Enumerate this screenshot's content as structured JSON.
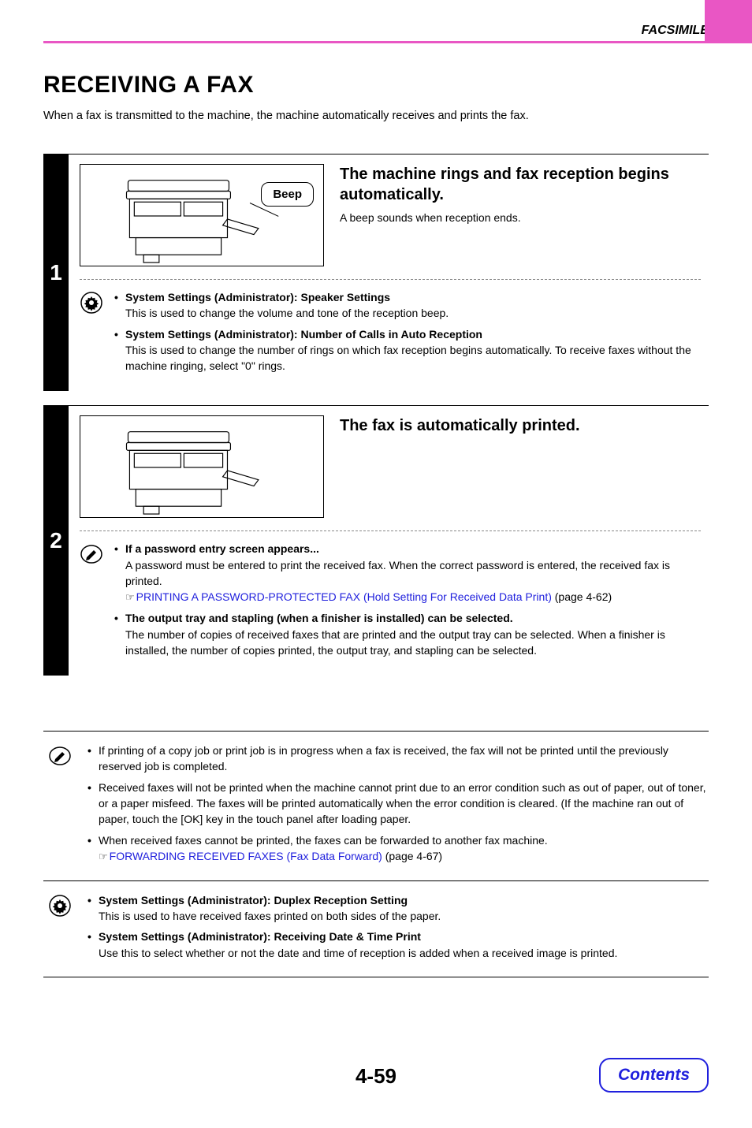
{
  "header": {
    "section": "FACSIMILE"
  },
  "title": "RECEIVING A FAX",
  "intro": "When a fax is transmitted to the machine, the machine automatically receives and prints the fax.",
  "step1": {
    "num": "1",
    "callout": "Beep",
    "heading": "The machine rings and fax reception begins automatically.",
    "desc": "A beep sounds when reception ends.",
    "notes": [
      {
        "bold": "System Settings (Administrator): Speaker Settings",
        "desc": "This is used to change the volume and tone of the reception beep."
      },
      {
        "bold": "System Settings (Administrator): Number of Calls in Auto Reception",
        "desc": "This is used to change the number of rings on which fax reception begins automatically. To receive faxes without the machine ringing, select \"0\" rings."
      }
    ]
  },
  "step2": {
    "num": "2",
    "heading": "The fax is automatically printed.",
    "notes": [
      {
        "bold": "If a password entry screen appears...",
        "desc": "A password must be entered to print the received fax. When the correct password is entered, the received fax is printed.",
        "link": "PRINTING A PASSWORD-PROTECTED FAX (Hold Setting For Received Data Print)",
        "linkref": " (page 4-62)"
      },
      {
        "bold": "The output tray and stapling (when a finisher is installed) can be selected.",
        "desc": "The number of copies of received faxes that are printed and the output tray can be selected. When a finisher is installed, the number of copies printed, the output tray, and stapling can be selected."
      }
    ]
  },
  "bottom1": [
    {
      "desc": "If printing of a copy job or print job is in progress when a fax is received, the fax will not be printed until the previously reserved job is completed."
    },
    {
      "desc": "Received faxes will not be printed when the machine cannot print due to an error condition such as out of paper, out of toner, or a paper misfeed. The faxes will be printed automatically when the error condition is cleared. (If the machine ran out of paper, touch the [OK] key in the touch panel after loading paper."
    },
    {
      "desc": "When received faxes cannot be printed, the faxes can be forwarded to another fax machine.",
      "link": "FORWARDING RECEIVED FAXES (Fax Data Forward)",
      "linkref": " (page 4-67)"
    }
  ],
  "bottom2": [
    {
      "bold": "System Settings (Administrator): Duplex Reception Setting",
      "desc": "This is used to have received faxes printed on both sides of the paper."
    },
    {
      "bold": "System Settings (Administrator): Receiving Date & Time Print",
      "desc": "Use this to select whether or not the date and time of reception is added when a received image is printed."
    }
  ],
  "footer": {
    "pagenum": "4-59",
    "contents": "Contents"
  },
  "pointer_glyph": "☞"
}
